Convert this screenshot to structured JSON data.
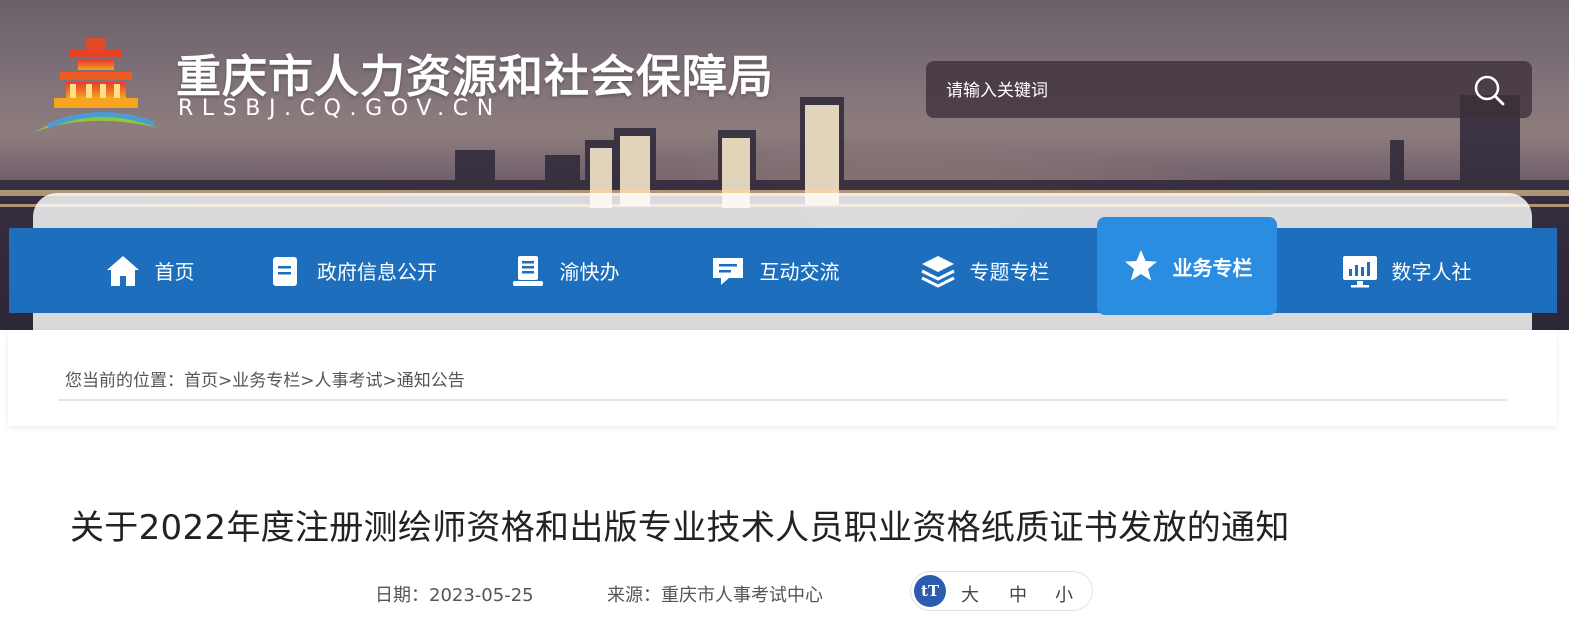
{
  "header": {
    "title": "重庆市人力资源和社会保障局",
    "domain": "RLSBJ.CQ.GOV.CN",
    "logo_icon": "temple-roof-logo-icon"
  },
  "search": {
    "placeholder": "请输入关键词",
    "icon": "search-icon"
  },
  "nav": {
    "items": [
      {
        "label": "首页",
        "icon": "home-icon"
      },
      {
        "label": "政府信息公开",
        "icon": "document-icon"
      },
      {
        "label": "渝快办",
        "icon": "book-icon"
      },
      {
        "label": "互动交流",
        "icon": "chat-icon"
      },
      {
        "label": "专题专栏",
        "icon": "layers-icon"
      },
      {
        "label": "业务专栏",
        "icon": "star-icon",
        "active": true
      },
      {
        "label": "数字人社",
        "icon": "monitor-chart-icon"
      }
    ]
  },
  "breadcrumb": {
    "prefix": "您当前的位置：",
    "items": [
      "首页",
      "业务专栏",
      "人事考试",
      "通知公告"
    ],
    "separator": ">"
  },
  "article": {
    "title": "关于2022年度注册测绘师资格和出版专业技术人员职业资格纸质证书发放的通知",
    "date_label": "日期：",
    "date": "2023-05-25",
    "source_label": "来源：",
    "source": "重庆市人事考试中心"
  },
  "font_size": {
    "icon_text": "tT",
    "options": [
      "大",
      "中",
      "小"
    ]
  },
  "colors": {
    "nav_bg": "#1d6fbd",
    "nav_active": "#2a8de0",
    "font_icon_bg": "#2d5bb0"
  }
}
